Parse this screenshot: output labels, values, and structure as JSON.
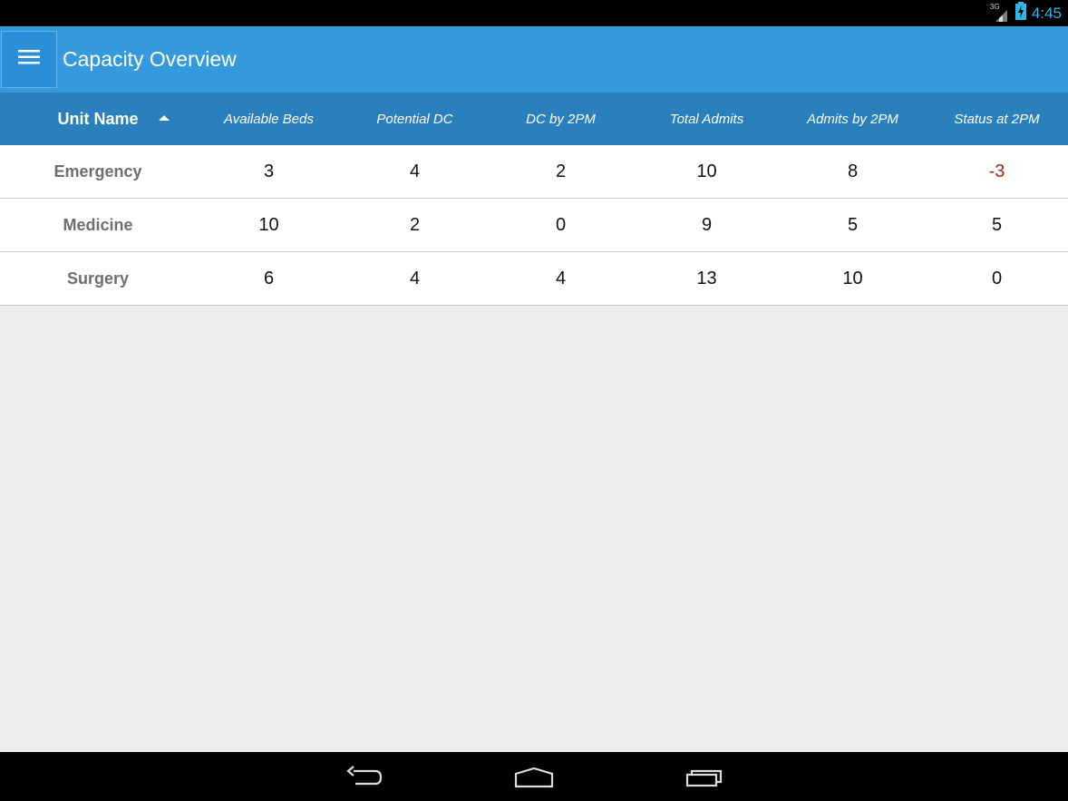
{
  "status_bar": {
    "network": "3G",
    "time": "4:45"
  },
  "app_bar": {
    "title": "Capacity Overview",
    "menu_icon": "hamburger-menu-icon"
  },
  "table": {
    "columns": [
      "Unit Name",
      "Available Beds",
      "Potential DC",
      "DC by 2PM",
      "Total Admits",
      "Admits by 2PM",
      "Status at 2PM"
    ],
    "sort": {
      "column": "Unit Name",
      "direction": "ascending"
    },
    "rows": [
      {
        "unit": "Emergency",
        "available_beds": "3",
        "potential_dc": "4",
        "dc_by_2pm": "2",
        "total_admits": "10",
        "admits_by_2pm": "8",
        "status_at_2pm": "-3"
      },
      {
        "unit": "Medicine",
        "available_beds": "10",
        "potential_dc": "2",
        "dc_by_2pm": "0",
        "total_admits": "9",
        "admits_by_2pm": "5",
        "status_at_2pm": "5"
      },
      {
        "unit": "Surgery",
        "available_beds": "6",
        "potential_dc": "4",
        "dc_by_2pm": "4",
        "total_admits": "13",
        "admits_by_2pm": "10",
        "status_at_2pm": "0"
      }
    ]
  },
  "colors": {
    "app_bar": "#3499dd",
    "table_header": "#2a7fbd",
    "negative_status": "#a02718",
    "status_bar_text": "#33b5e5"
  },
  "nav_bar": {
    "icons": [
      "back-icon",
      "home-icon",
      "recent-apps-icon"
    ]
  }
}
